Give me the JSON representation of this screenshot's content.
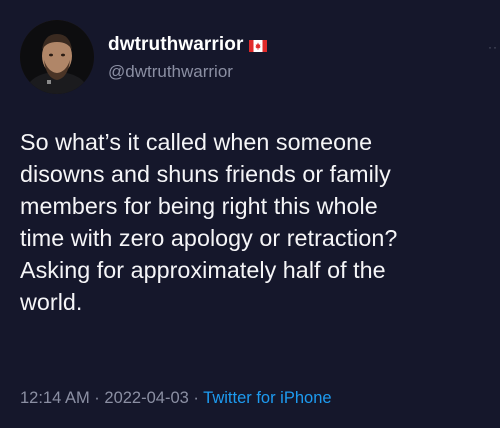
{
  "user": {
    "display_name": "dwtruthwarrior",
    "handle": "@dwtruthwarrior",
    "flag_icon": "canada-flag-icon"
  },
  "tweet": {
    "lines": [
      "So what’s it called when someone",
      "disowns and shuns friends or family",
      "members for being right this whole",
      "time with zero apology or retraction?",
      "Asking for approximately half of the",
      "world."
    ]
  },
  "meta": {
    "time": "12:14 AM",
    "separator": " · ",
    "date": "2022-04-03",
    "source": "Twitter for iPhone"
  },
  "colors": {
    "background": "#15172b",
    "link": "#1d9bf0",
    "muted": "#8b8fa3"
  }
}
